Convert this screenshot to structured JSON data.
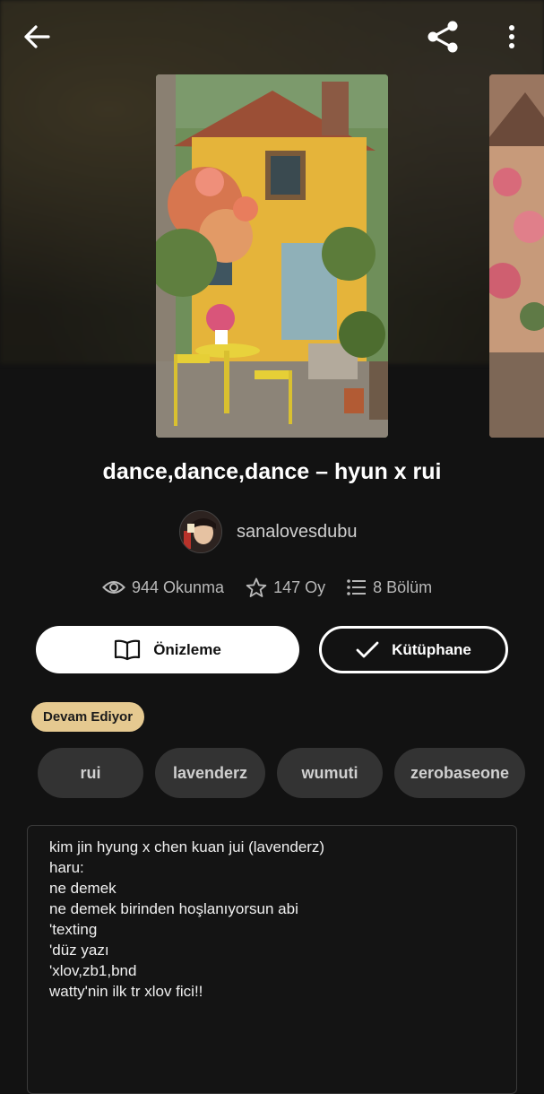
{
  "header": {
    "back_icon": "arrow-left-icon",
    "share_icon": "share-icon",
    "more_icon": "more-vertical-icon"
  },
  "story": {
    "title": "dance,dance,dance – hyun x rui",
    "author": "sanalovesdubu"
  },
  "stats": {
    "reads": "944 Okunma",
    "votes": "147 Oy",
    "parts": "8 Bölüm"
  },
  "actions": {
    "preview_label": "Önizleme",
    "library_label": "Kütüphane"
  },
  "status": "Devam Ediyor",
  "tags": [
    "rui",
    "lavenderz",
    "wumuti",
    "zerobaseone"
  ],
  "description": [
    "kim jin hyung x chen kuan jui (lavenderz)",
    "",
    "haru:",
    "ne demek",
    "ne demek birinden hoşlanıyorsun abi",
    "",
    "'texting",
    "'düz yazı",
    "'xlov,zb1,bnd",
    "",
    "watty'nin ilk tr xlov fici!!"
  ],
  "colors": {
    "background": "#121212",
    "badge": "#e5c990",
    "tag_bg": "#333333"
  }
}
